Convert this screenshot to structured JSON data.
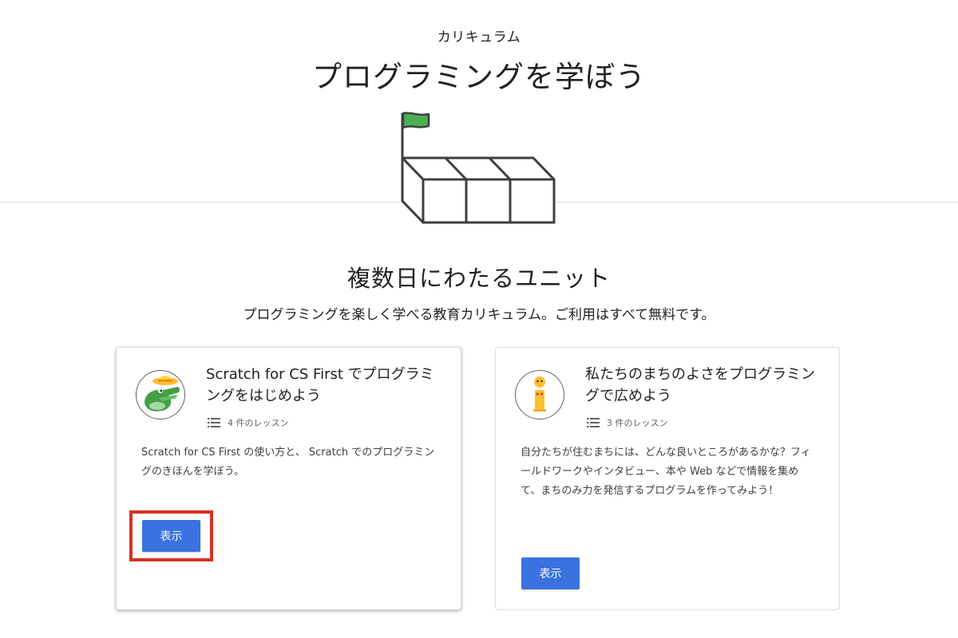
{
  "header": {
    "eyebrow": "カリキュラム",
    "title": "プログラミングを学ぼう"
  },
  "section": {
    "title": "複数日にわたるユニット",
    "subtitle": "プログラミングを楽しく学べる教育カリキュラム。ご利用はすべて無料です。"
  },
  "cards": [
    {
      "title": "Scratch for CS First でプログラミングをはじめよう",
      "lessons": "4 件のレッスン",
      "description": "Scratch for CS First の使い方と、 Scratch でのプログラミングのきほんを学ぼう。",
      "button_label": "表示",
      "avatar_icon": "crocodile-with-hat-icon",
      "highlighted": true
    },
    {
      "title": "私たちのまちのよさをプログラミングで広めよう",
      "lessons": "3 件のレッスン",
      "description": "自分たちが住むまちには、どんな良いところがあるかな？フィールドワークやインタビュー、本や Web などで情報を集めて、まちのみ力を発信するプログラムを作ってみよう！",
      "button_label": "表示",
      "avatar_icon": "info-character-icon",
      "highlighted": false
    }
  ],
  "colors": {
    "button": "#3a72e0",
    "highlight": "#d93025",
    "flag": "#4caf50",
    "divider": "#dadce0"
  },
  "icons": {
    "hero": "flag-on-blocks-icon",
    "lessons": "list-icon"
  }
}
